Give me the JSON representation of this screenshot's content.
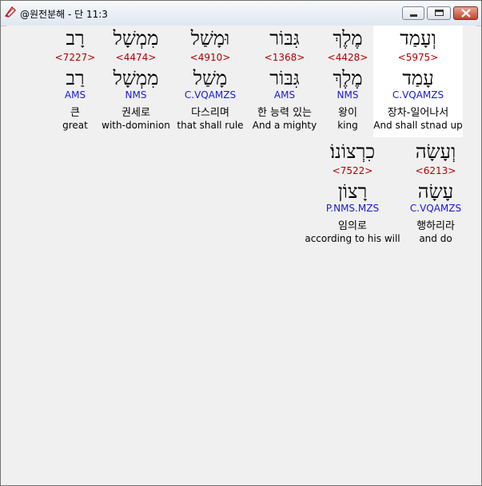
{
  "window": {
    "title": "@원전분해 - 단 11:3"
  },
  "row1": [
    {
      "hebrew": "וְעָמַד",
      "strong": "<5975>",
      "lemma": "עָמַד",
      "parse": "C.VQAMZS",
      "korean": "장차-일어나서",
      "english": "And shall stnad up"
    },
    {
      "hebrew": "מֶלֶךְ",
      "strong": "<4428>",
      "lemma": "מֶלֶךְ",
      "parse": "NMS",
      "korean": "왕이",
      "english": "king"
    },
    {
      "hebrew": "גִּבּוֹר",
      "strong": "<1368>",
      "lemma": "גִּבּוֹר",
      "parse": "AMS",
      "korean": "한 능력 있는",
      "english": "And a mighty"
    },
    {
      "hebrew": "וּמָשַׁל",
      "strong": "<4910>",
      "lemma": "מָשַׁל",
      "parse": "C.VQAMZS",
      "korean": "다스리며",
      "english": "that shall rule"
    },
    {
      "hebrew": "מִמְשָׁל",
      "strong": "<4474>",
      "lemma": "מִמְשָׁל",
      "parse": "NMS",
      "korean": "권세로",
      "english": "with-dominion"
    },
    {
      "hebrew": "רָב",
      "strong": "<7227>",
      "lemma": "רַב",
      "parse": "AMS",
      "korean": "큰",
      "english": "great"
    }
  ],
  "row2": [
    {
      "hebrew": "וְעָשָׂה",
      "strong": "<6213>",
      "lemma": "עָשָׂה",
      "parse": "C.VQAMZS",
      "korean": "행하리라",
      "english": "and do"
    },
    {
      "hebrew": "כִרְצוֹנוֹ׃",
      "strong": "<7522>",
      "lemma": "רָצוֹן",
      "parse": "P.NMS.MZS",
      "korean": "임의로",
      "english": "according to his will"
    }
  ]
}
